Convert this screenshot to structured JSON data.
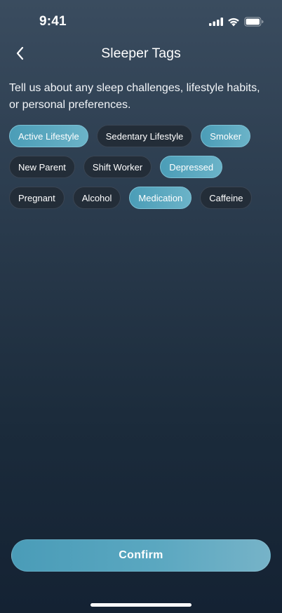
{
  "status_bar": {
    "time": "9:41",
    "icons": [
      "signal-icon",
      "wifi-icon",
      "battery-icon"
    ]
  },
  "header": {
    "back_icon": "chevron-left-icon",
    "title": "Sleeper Tags"
  },
  "description": "Tell us about any sleep challenges, lifestyle habits, or personal preferences.",
  "tags": [
    {
      "label": "Active Lifestyle",
      "selected": true
    },
    {
      "label": "Sedentary Lifestyle",
      "selected": false
    },
    {
      "label": "Smoker",
      "selected": true
    },
    {
      "label": "New Parent",
      "selected": false
    },
    {
      "label": "Shift Worker",
      "selected": false
    },
    {
      "label": "Depressed",
      "selected": true
    },
    {
      "label": "Pregnant",
      "selected": false
    },
    {
      "label": "Alcohol",
      "selected": false
    },
    {
      "label": "Medication",
      "selected": true
    },
    {
      "label": "Caffeine",
      "selected": false
    }
  ],
  "confirm_label": "Confirm",
  "colors": {
    "selected_tag": "#4b9db7",
    "unselected_tag": "#232d38",
    "background_top": "#3a4c5f",
    "background_bottom": "#142233"
  }
}
